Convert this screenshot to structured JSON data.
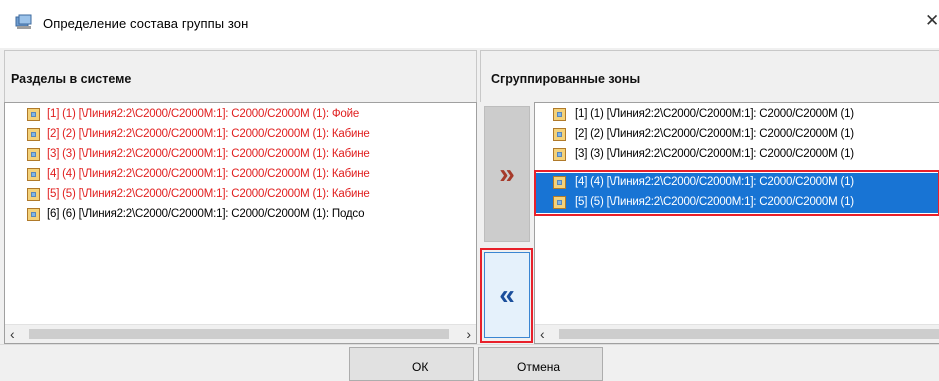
{
  "window": {
    "title": "Определение состава группы зон",
    "close_glyph": "✕",
    "icon": "group-icon"
  },
  "left_panel": {
    "header": "Разделы в системе",
    "items": [
      {
        "text": "[1] (1) [\\Линия2:2\\С2000/С2000М:1]: С2000/С2000М (1): Фойе",
        "color": "#e01e1e"
      },
      {
        "text": "[2] (2) [\\Линия2:2\\С2000/С2000М:1]: С2000/С2000М (1): Кабине",
        "color": "#e01e1e"
      },
      {
        "text": "[3] (3) [\\Линия2:2\\С2000/С2000М:1]: С2000/С2000М (1): Кабине",
        "color": "#e01e1e"
      },
      {
        "text": "[4] (4) [\\Линия2:2\\С2000/С2000М:1]: С2000/С2000М (1): Кабине",
        "color": "#e01e1e"
      },
      {
        "text": "[5] (5) [\\Линия2:2\\С2000/С2000М:1]: С2000/С2000М (1): Кабине",
        "color": "#e01e1e"
      },
      {
        "text": "[6] (6) [\\Линия2:2\\С2000/С2000М:1]: С2000/С2000М (1): Подсо",
        "color": "#000000"
      }
    ]
  },
  "right_panel": {
    "header": "Сгруппированные зоны",
    "items": [
      {
        "text": "[1] (1) [\\Линия2:2\\С2000/С2000М:1]: С2000/С2000М (1)",
        "selected": false
      },
      {
        "text": "[2] (2) [\\Линия2:2\\С2000/С2000М:1]: С2000/С2000М (1)",
        "selected": false
      },
      {
        "text": "[3] (3) [\\Линия2:2\\С2000/С2000М:1]: С2000/С2000М (1)",
        "selected": false
      },
      {
        "text": "[4] (4) [\\Линия2:2\\С2000/С2000М:1]: С2000/С2000М (1)",
        "selected": true
      },
      {
        "text": "[5] (5) [\\Линия2:2\\С2000/С2000М:1]: С2000/С2000М (1)",
        "selected": true
      }
    ]
  },
  "move_buttons": {
    "add_glyph": "»",
    "remove_glyph": "«"
  },
  "scroll": {
    "left_glyph": "‹",
    "right_glyph": "›"
  },
  "buttons": {
    "ok": "ОК",
    "cancel": "Отмена"
  },
  "colors": {
    "selection": "#1874d4",
    "highlight": "#e8202a",
    "error_text": "#e01e1e"
  }
}
